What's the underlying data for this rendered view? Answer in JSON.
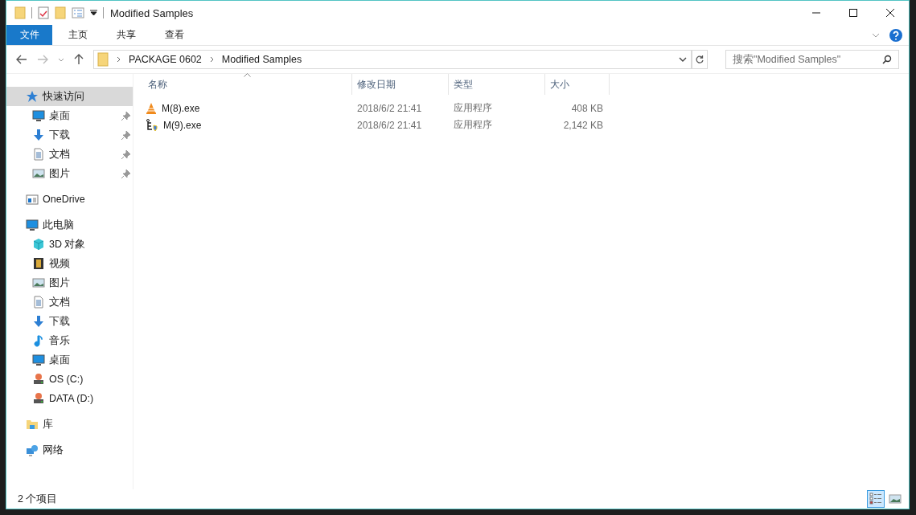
{
  "window": {
    "title": "Modified Samples"
  },
  "ribbon_tabs": [
    {
      "label": "文件",
      "selected": true
    },
    {
      "label": "主页",
      "selected": false
    },
    {
      "label": "共享",
      "selected": false
    },
    {
      "label": "查看",
      "selected": false
    }
  ],
  "address": {
    "path": [
      "PACKAGE 0602",
      "Modified Samples"
    ]
  },
  "search": {
    "placeholder": "搜索\"Modified Samples\""
  },
  "sidebar": {
    "groups": [
      {
        "label": "快速访问",
        "selected": true,
        "children": [
          {
            "label": "桌面",
            "pinned": true
          },
          {
            "label": "下载",
            "pinned": true
          },
          {
            "label": "文档",
            "pinned": true
          },
          {
            "label": "图片",
            "pinned": true
          }
        ]
      },
      {
        "label": "OneDrive",
        "selected": false
      },
      {
        "label": "此电脑",
        "selected": false,
        "children": [
          {
            "label": "3D 对象",
            "pinned": false
          },
          {
            "label": "视频",
            "pinned": false
          },
          {
            "label": "图片",
            "pinned": false
          },
          {
            "label": "文档",
            "pinned": false
          },
          {
            "label": "下载",
            "pinned": false
          },
          {
            "label": "音乐",
            "pinned": false
          },
          {
            "label": "桌面",
            "pinned": false
          },
          {
            "label": "OS (C:)",
            "pinned": false
          },
          {
            "label": "DATA (D:)",
            "pinned": false
          }
        ]
      },
      {
        "label": "库",
        "selected": false
      },
      {
        "label": "网络",
        "selected": false
      }
    ]
  },
  "table": {
    "columns": [
      {
        "label": "名称",
        "sorted": true
      },
      {
        "label": "修改日期",
        "sorted": false
      },
      {
        "label": "类型",
        "sorted": false
      },
      {
        "label": "大小",
        "sorted": false
      }
    ],
    "rows": [
      {
        "name": "M(8).exe",
        "modified": "2018/6/2 21:41",
        "type": "应用程序",
        "size": "408 KB"
      },
      {
        "name": "M(9).exe",
        "modified": "2018/6/2 21:41",
        "type": "应用程序",
        "size": "2,142 KB"
      }
    ]
  },
  "status_bar": {
    "item_count": "2 个项目"
  },
  "view_buttons": [
    {
      "selected": true
    },
    {
      "selected": false
    }
  ]
}
